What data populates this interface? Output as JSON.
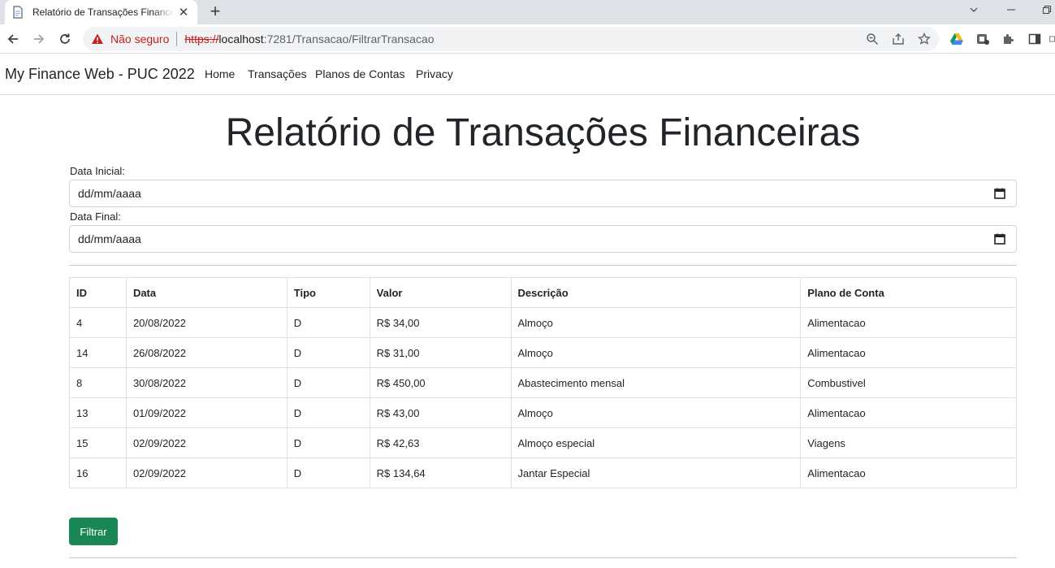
{
  "browser": {
    "tab_title": "Relatório de Transações Financeiras - MyFinance",
    "new_tab_symbol": "+",
    "security_label": "Não seguro",
    "url_scheme": "https://",
    "url_host": "localhost",
    "url_path": ":7281/Transacao/FiltrarTransacao",
    "icons": [
      "back-icon",
      "forward-icon",
      "reload-icon",
      "warning-icon",
      "zoom-icon",
      "share-icon",
      "star-icon",
      "google-drive-icon",
      "extension-icon",
      "puzzle-icon",
      "sidebar-icon"
    ]
  },
  "navbar": {
    "brand": "My Finance Web - PUC 2022",
    "links": [
      "Home",
      "Transações",
      "Planos de Contas",
      "Privacy"
    ]
  },
  "page": {
    "title": "Relatório de Transações Financeiras",
    "data_inicial_label": "Data Inicial:",
    "data_final_label": "Data Final:",
    "date_placeholder": "dd/mm/aaaa"
  },
  "table": {
    "headers": [
      "ID",
      "Data",
      "Tipo",
      "Valor",
      "Descrição",
      "Plano de Conta"
    ],
    "rows": [
      [
        "4",
        "20/08/2022",
        "D",
        "R$ 34,00",
        "Almoço",
        "Alimentacao"
      ],
      [
        "14",
        "26/08/2022",
        "D",
        "R$ 31,00",
        "Almoço",
        "Alimentacao"
      ],
      [
        "8",
        "30/08/2022",
        "D",
        "R$ 450,00",
        "Abastecimento mensal",
        "Combustivel"
      ],
      [
        "13",
        "01/09/2022",
        "D",
        "R$ 43,00",
        "Almoço",
        "Alimentacao"
      ],
      [
        "15",
        "02/09/2022",
        "D",
        "R$ 42,63",
        "Almoço especial",
        "Viagens"
      ],
      [
        "16",
        "02/09/2022",
        "D",
        "R$ 134,64",
        "Jantar Especial",
        "Alimentacao"
      ]
    ]
  },
  "buttons": {
    "filter": "Filtrar"
  },
  "colors": {
    "primary_success": "#198754",
    "not_secure": "#c5221f"
  }
}
